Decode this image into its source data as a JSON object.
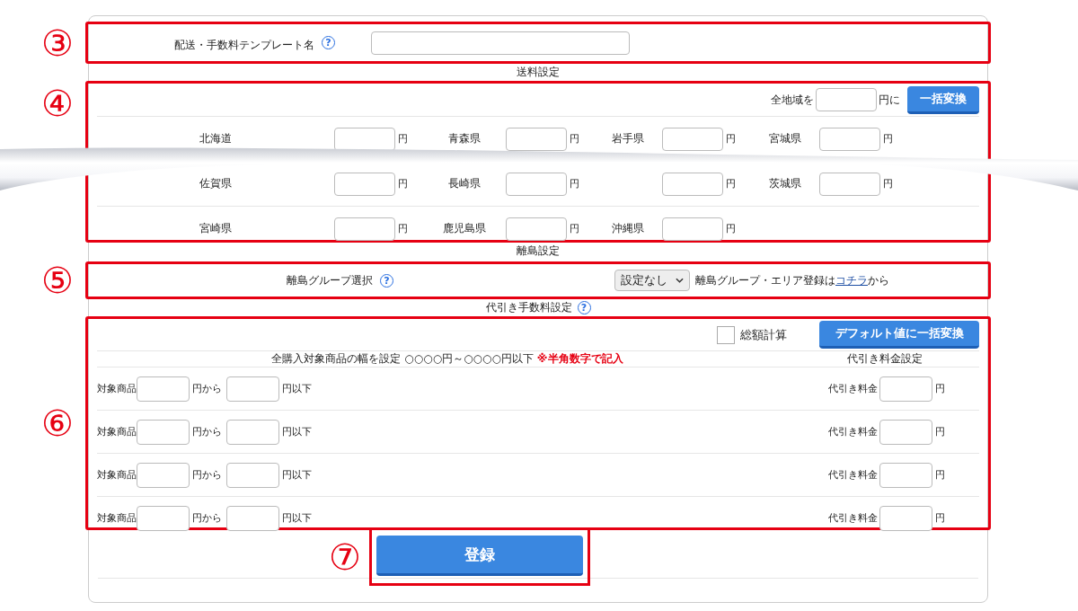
{
  "template_name": {
    "marker": "③",
    "label": "配送・手数料テンプレート名",
    "help": "?"
  },
  "shipping": {
    "title": "送料設定",
    "marker": "④",
    "bulk": {
      "prefix": "全地域を",
      "suffix": "円に",
      "button": "一括変換"
    },
    "rows": [
      [
        {
          "pref": "北海道",
          "unit": "円"
        },
        {
          "pref": "青森県",
          "unit": "円"
        },
        {
          "pref": "岩手県",
          "unit": "円"
        },
        {
          "pref": "宮城県",
          "unit": "円"
        }
      ],
      [
        {
          "pref": "佐賀県",
          "unit": "円"
        },
        {
          "pref": "長崎県",
          "unit": "円"
        },
        {
          "unit": "円"
        },
        {
          "pref": "茨城県",
          "unit": "円"
        }
      ],
      [
        {
          "pref": "宮崎県",
          "unit": "円"
        },
        {
          "pref": "鹿児島県",
          "unit": "円"
        },
        {
          "pref": "沖縄県",
          "unit": "円"
        }
      ]
    ]
  },
  "remote": {
    "title": "離島設定",
    "marker": "⑤",
    "label": "離島グループ選択",
    "help": "?",
    "select": "設定なし",
    "note_before": "離島グループ・エリア登録は",
    "note_link": "コチラ",
    "note_after": "から"
  },
  "cod": {
    "title": "代引き手数料設定",
    "help": "?",
    "marker": "⑥",
    "total": {
      "label": "総額計算",
      "checked": false
    },
    "button": "デフォルト値に一括変換",
    "range_header": "全購入対象商品の幅を設定 ○○○○円～○○○○円以下",
    "warning": "※半角数字で記入",
    "fee_header": "代引き料金設定",
    "rows": [
      {
        "label": "対象商品",
        "from": "円から",
        "to": "円以下",
        "fee_label": "代引き料金",
        "unit": "円"
      },
      {
        "label": "対象商品",
        "from": "円から",
        "to": "円以下",
        "fee_label": "代引き料金",
        "unit": "円"
      },
      {
        "label": "対象商品",
        "from": "円から",
        "to": "円以下",
        "fee_label": "代引き料金",
        "unit": "円"
      },
      {
        "label": "対象商品",
        "from": "円から",
        "to": "円以下",
        "fee_label": "代引き料金",
        "unit": "円"
      }
    ]
  },
  "submit": {
    "marker": "⑦",
    "label": "登録"
  }
}
